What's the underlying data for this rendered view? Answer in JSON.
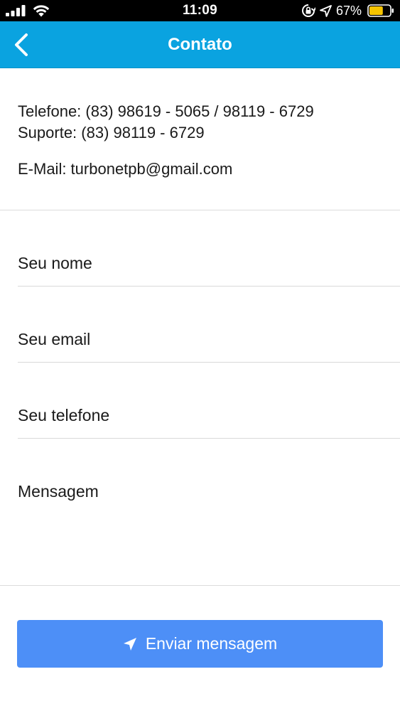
{
  "status_bar": {
    "time": "11:09",
    "battery_percent": "67%",
    "signal_icon": "cellular-signal-icon",
    "wifi_icon": "wifi-icon",
    "orientation_lock_icon": "orientation-lock-icon",
    "location_icon": "location-arrow-icon",
    "battery_icon": "battery-icon",
    "battery_level": 0.67,
    "battery_color": "#f5c400"
  },
  "nav": {
    "title": "Contato",
    "back_icon": "chevron-left-icon",
    "background_color": "#0aa3e0"
  },
  "contact": {
    "phone": "Telefone: (83) 98619 - 5065 / 98119 - 6729",
    "support": "Suporte: (83) 98119 - 6729",
    "email": "E-Mail: turbonetpb@gmail.com"
  },
  "form": {
    "name_placeholder": "Seu nome",
    "email_placeholder": "Seu email",
    "phone_placeholder": "Seu telefone",
    "message_placeholder": "Mensagem",
    "submit_label": "Enviar mensagem",
    "submit_icon": "paper-plane-icon",
    "submit_color": "#4d8ff7"
  }
}
